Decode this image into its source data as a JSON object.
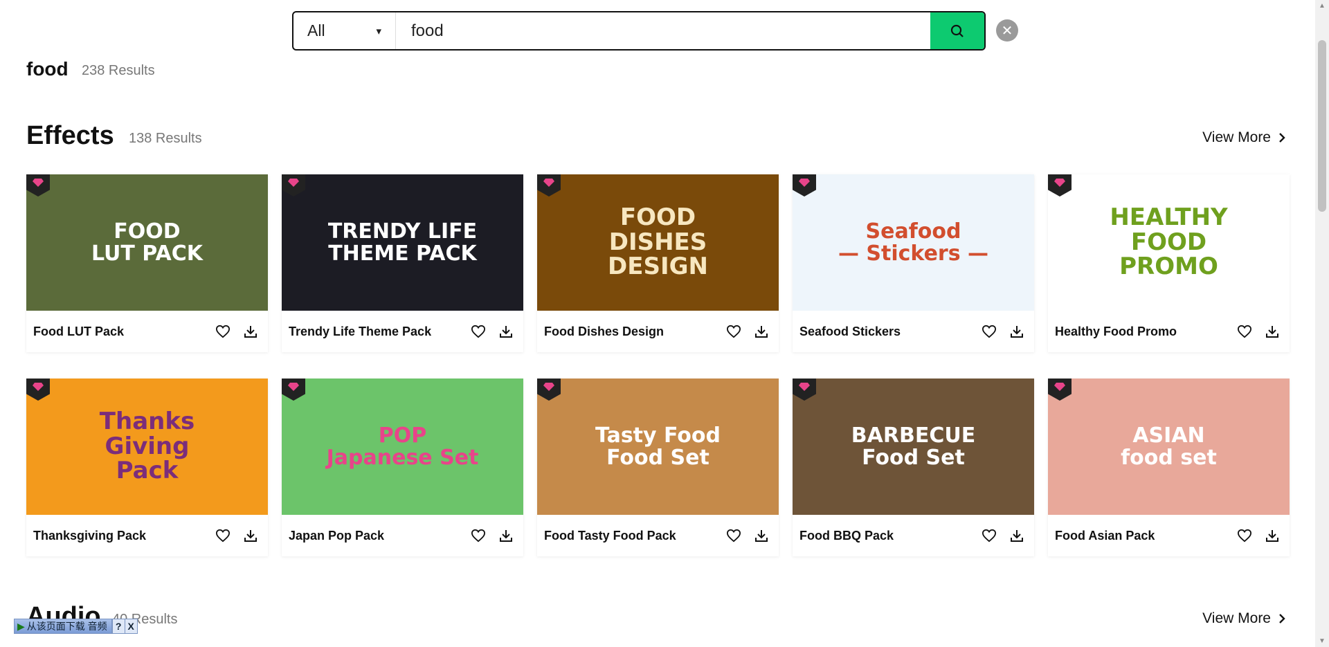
{
  "search": {
    "category": "All",
    "query": "food",
    "caret": "▾",
    "clear_label": "✕"
  },
  "previous": {
    "title": "food",
    "count": "238 Results"
  },
  "effects": {
    "title": "Effects",
    "count": "138 Results",
    "view_more": "View More",
    "items": [
      {
        "title": "Food LUT Pack",
        "thumb_text": "FOOD\nLUT PACK",
        "bg": "#5b6b3a",
        "fg": "#ffffff"
      },
      {
        "title": "Trendy Life Theme Pack",
        "thumb_text": "TRENDY LIFE\nTHEME PACK",
        "bg": "#1c1c24",
        "fg": "#ffffff"
      },
      {
        "title": "Food Dishes Design",
        "thumb_text": "FOOD\nDISHES\nDESIGN",
        "bg": "#7a4a0a",
        "fg": "#f7e7c0"
      },
      {
        "title": "Seafood Stickers",
        "thumb_text": "Seafood\n— Stickers —",
        "bg": "#eef5fb",
        "fg": "#d24e2e"
      },
      {
        "title": "Healthy Food Promo",
        "thumb_text": "HEALTHY\nFOOD\nPROMO",
        "bg": "#ffffff",
        "fg": "#6fa01e"
      },
      {
        "title": "Thanksgiving Pack",
        "thumb_text": "Thanks\nGiving\nPack",
        "bg": "#f39a1c",
        "fg": "#7b2d7b"
      },
      {
        "title": "Japan Pop Pack",
        "thumb_text": "POP\nJapanese Set",
        "bg": "#6cc46a",
        "fg": "#e8448a"
      },
      {
        "title": "Food Tasty Food Pack",
        "thumb_text": "Tasty Food\nFood Set",
        "bg": "#c58a4a",
        "fg": "#ffffff"
      },
      {
        "title": "Food BBQ Pack",
        "thumb_text": "BARBECUE\nFood Set",
        "bg": "#6e5438",
        "fg": "#ffffff"
      },
      {
        "title": "Food Asian Pack",
        "thumb_text": "ASIAN\nfood set",
        "bg": "#e8a89a",
        "fg": "#ffffff"
      }
    ]
  },
  "audio": {
    "title": "Audio",
    "count": "40 Results",
    "view_more": "View More"
  },
  "download_bar": {
    "label": "从该页面下载 音频",
    "help": "?",
    "close": "X"
  },
  "colors": {
    "accent": "#0dca70",
    "gem": "#e8448a"
  }
}
